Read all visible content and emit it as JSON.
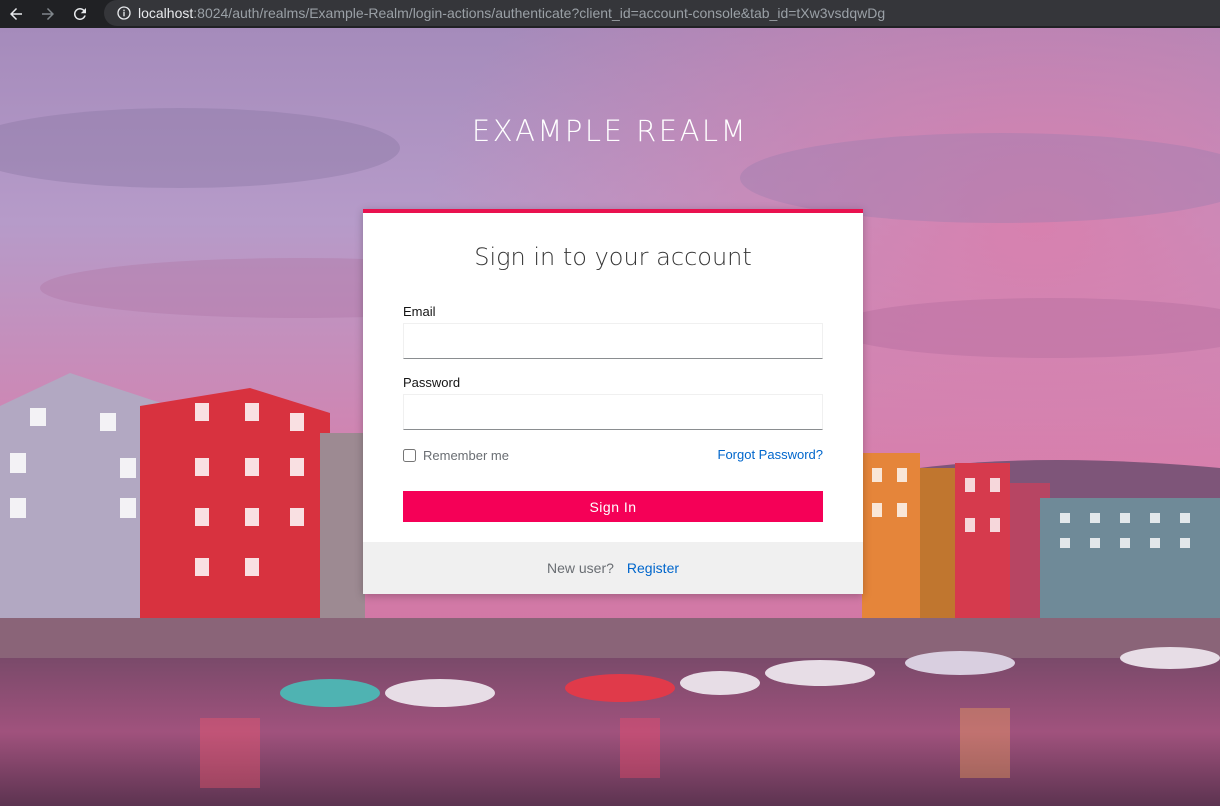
{
  "browser": {
    "url_host": "localhost",
    "url_rest": ":8024/auth/realms/Example-Realm/login-actions/authenticate?client_id=account-console&tab_id=tXw3vsdqwDg"
  },
  "realm": {
    "title": "EXAMPLE REALM"
  },
  "login": {
    "heading": "Sign in to your account",
    "email_label": "Email",
    "email_value": "",
    "password_label": "Password",
    "password_value": "",
    "remember_label": "Remember me",
    "forgot_label": "Forgot Password?",
    "signin_label": "Sign In",
    "new_user_text": "New user?",
    "register_label": "Register"
  },
  "colors": {
    "accent": "#f50057",
    "card_top_border": "#e9114f",
    "link": "#0066cc"
  }
}
